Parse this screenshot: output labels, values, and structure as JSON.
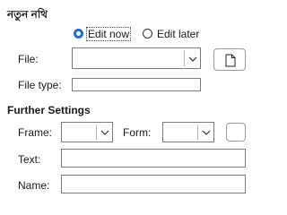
{
  "section_new_document": {
    "title": "নতুন নথি",
    "options": [
      {
        "label": "Edit now",
        "selected": true
      },
      {
        "label": "Edit later",
        "selected": false
      }
    ],
    "file_label": "File:",
    "file_value": "",
    "file_type_label": "File type:",
    "file_type_value": ""
  },
  "section_further": {
    "title": "Further Settings",
    "frame_label": "Frame:",
    "frame_value": "",
    "form_label": "Form:",
    "form_value": "",
    "text_label": "Text:",
    "text_value": "",
    "name_label": "Name:",
    "name_value": ""
  },
  "icons": {
    "browse": "document-icon",
    "chevron": "chevron-down-icon"
  },
  "colors": {
    "accent": "#1f6fd1",
    "border": "#7a7a7a"
  }
}
